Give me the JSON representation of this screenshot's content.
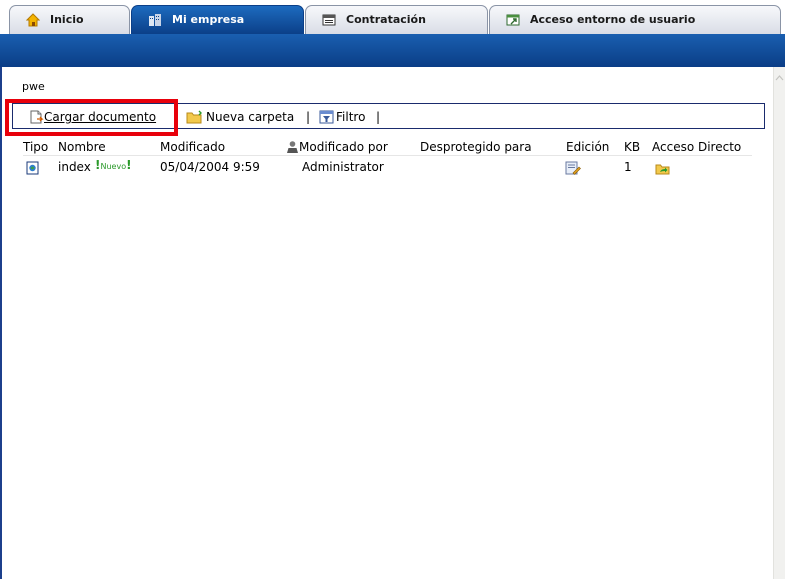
{
  "tabs": [
    {
      "label": "Inicio",
      "icon": "home-icon"
    },
    {
      "label": "Mi empresa",
      "icon": "building-icon"
    },
    {
      "label": "Contratación",
      "icon": "form-icon"
    },
    {
      "label": "Acceso entorno de usuario",
      "icon": "window-arrow-icon"
    }
  ],
  "active_tab": "Mi empresa",
  "site_title": "pwe",
  "toolbar": {
    "upload_label": "Cargar documento",
    "new_folder_label": "Nueva carpeta",
    "filter_label": "Filtro",
    "separator": "|"
  },
  "columns": [
    "Tipo",
    "Nombre",
    "Modificado",
    "Modificado por",
    "Desprotegido para",
    "Edición",
    "KB",
    "Acceso Directo"
  ],
  "rows": [
    {
      "name": "index",
      "badge": "Nuevo",
      "badge_mark": "!",
      "modified": "05/04/2004 9:59",
      "modified_by": "Administrator",
      "checked_out_to": "",
      "kb": "1"
    }
  ],
  "colors": {
    "accent_blue": "#0b3f88",
    "highlight_red": "#e8000b",
    "badge_green": "#2b9a2b"
  }
}
